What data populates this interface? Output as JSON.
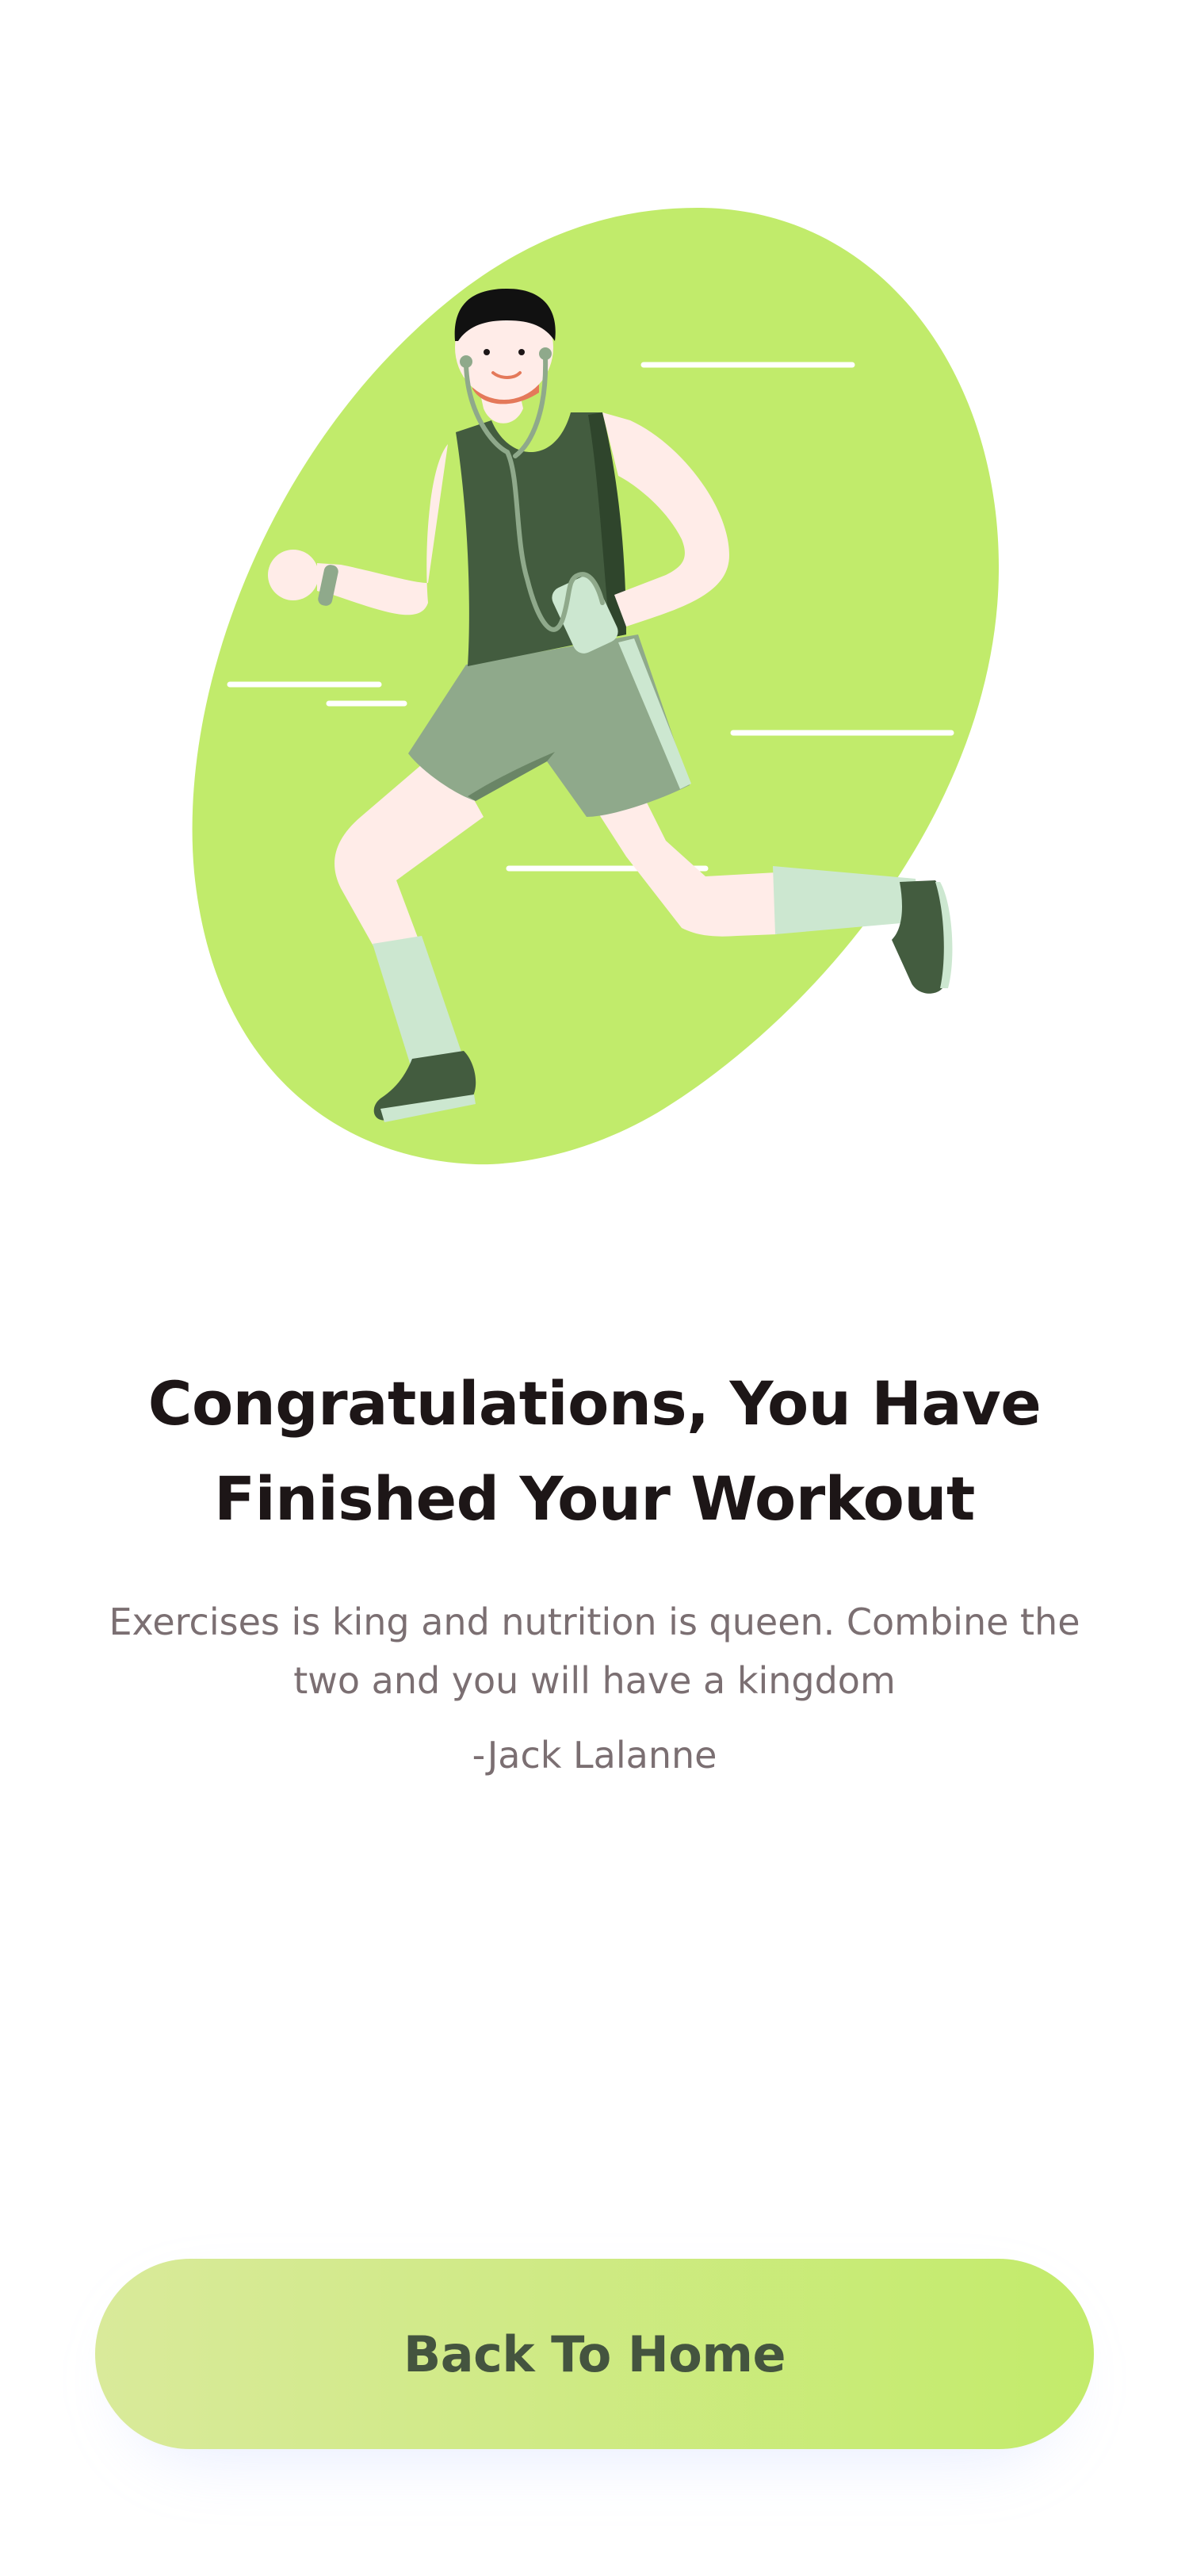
{
  "colors": {
    "accent_green": "#c1eb6b",
    "title_text": "#1d1617",
    "body_text": "#7b6f72",
    "button_text": "#44543f"
  },
  "illustration": {
    "icon": "running-man-illustration"
  },
  "content": {
    "title_line1": "Congratulations, You Have",
    "title_line2": "Finished Your Workout",
    "quote": "Exercises is king and nutrition is queen. Combine the two and you will have a kingdom",
    "author": "-Jack Lalanne"
  },
  "cta": {
    "label": "Back To Home"
  }
}
